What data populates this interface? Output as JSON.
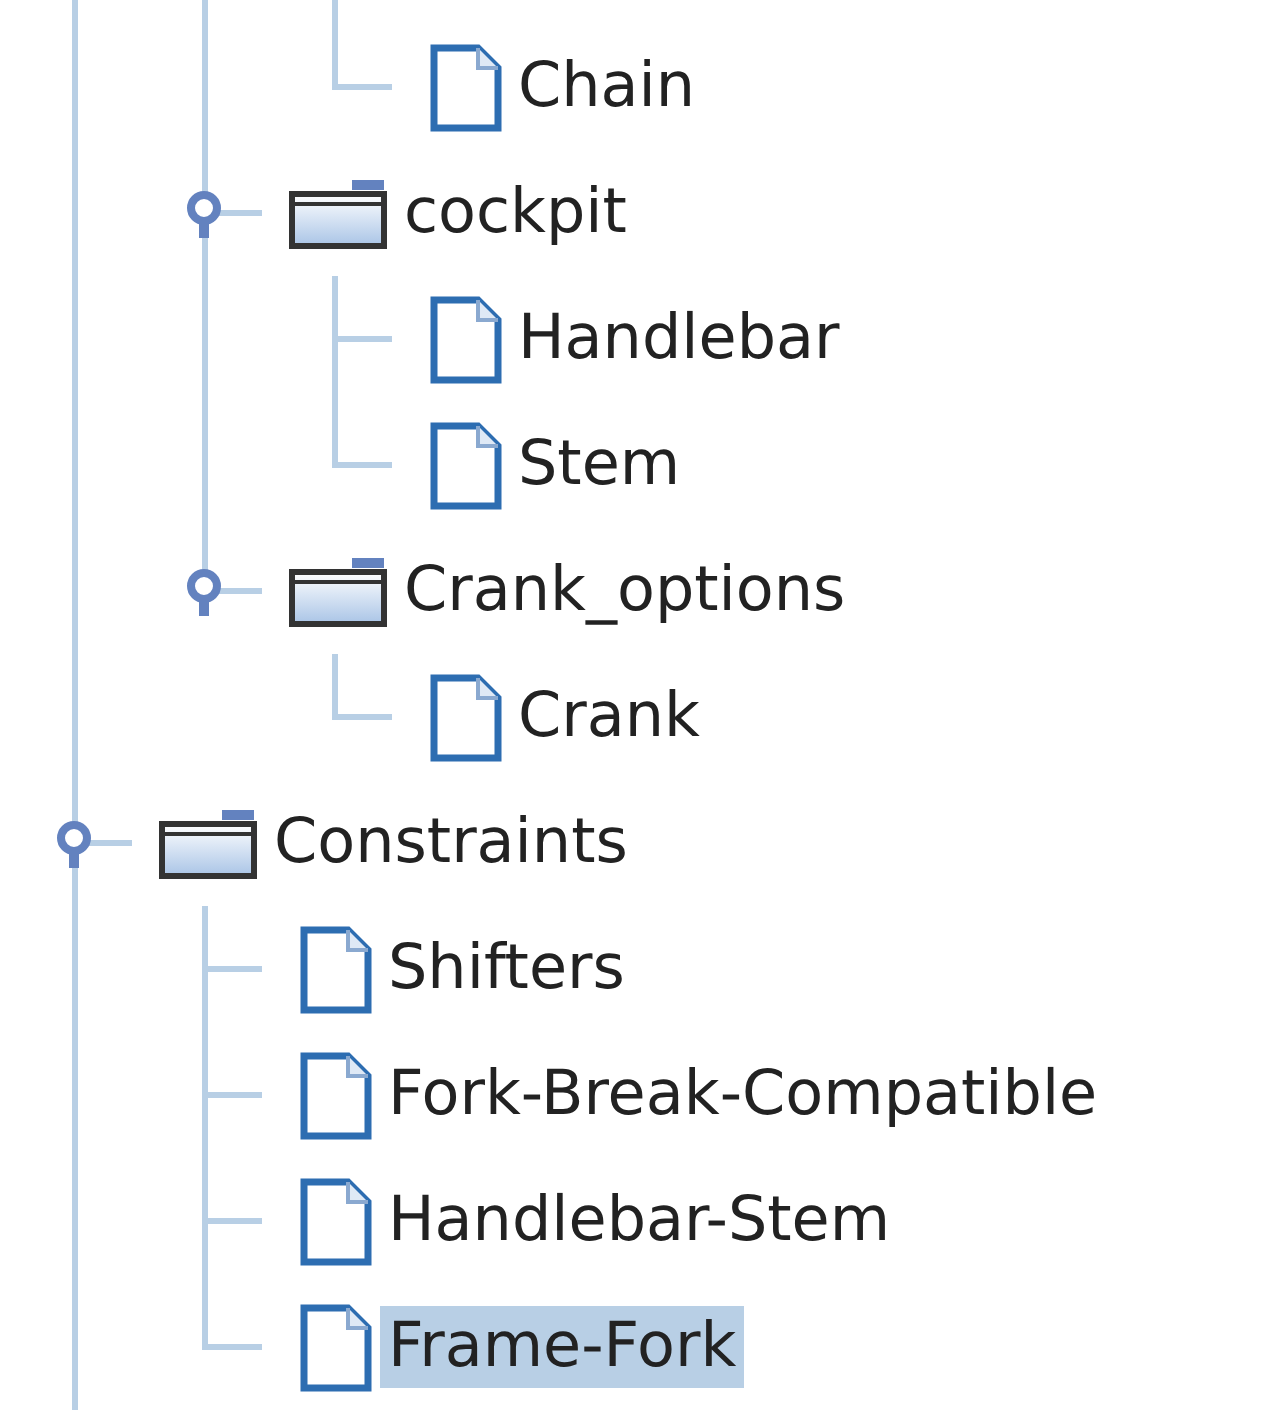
{
  "tree": {
    "continues_below": true,
    "nodes": [
      {
        "children": [
          {
            "children": [
              {
                "kind": "leaf",
                "label": "Chain",
                "selected": false
              }
            ]
          },
          {
            "kind": "folder",
            "label": "cockpit",
            "expanded": true,
            "selected": false,
            "children": [
              {
                "kind": "leaf",
                "label": "Handlebar",
                "selected": false
              },
              {
                "kind": "leaf",
                "label": "Stem",
                "selected": false
              }
            ]
          },
          {
            "kind": "folder",
            "label": "Crank_options",
            "expanded": true,
            "selected": false,
            "children": [
              {
                "kind": "leaf",
                "label": "Crank",
                "selected": false
              }
            ]
          }
        ]
      },
      {
        "kind": "folder",
        "label": "Constraints",
        "expanded": true,
        "selected": false,
        "children": [
          {
            "kind": "leaf",
            "label": "Shifters",
            "selected": false
          },
          {
            "kind": "leaf",
            "label": "Fork-Break-Compatible",
            "selected": false
          },
          {
            "kind": "leaf",
            "label": "Handlebar-Stem",
            "selected": false
          },
          {
            "kind": "leaf",
            "label": "Frame-Fork",
            "selected": true
          }
        ]
      }
    ]
  }
}
